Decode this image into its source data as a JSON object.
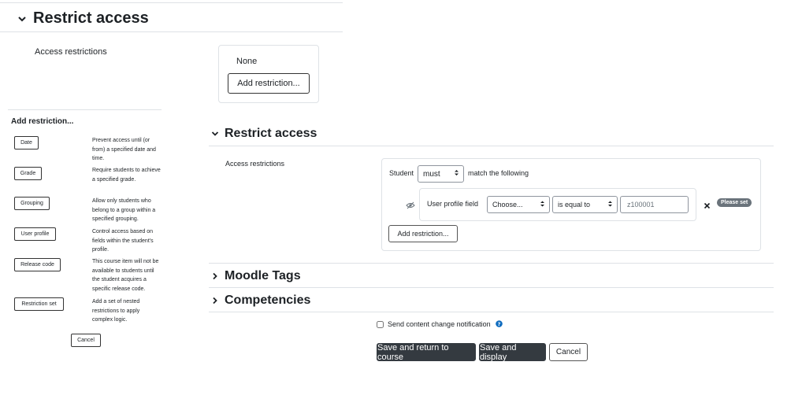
{
  "top_section": {
    "title": "Restrict access",
    "label": "Access restrictions",
    "none_text": "None",
    "add_button": "Add restriction..."
  },
  "dialog": {
    "title": "Add restriction...",
    "items": [
      {
        "button": "Date",
        "desc": "Prevent access until (or from) a specified date and time."
      },
      {
        "button": "Grade",
        "desc": "Require students to achieve a specified grade."
      },
      {
        "button": "Grouping",
        "desc": "Allow only students who belong to a group within a specified grouping."
      },
      {
        "button": "User profile",
        "desc": "Control access based on fields within the student's profile."
      },
      {
        "button": "Release code",
        "desc": "This course item will not be available to students until the student acquires a specific release code."
      },
      {
        "button": "Restriction set",
        "desc": "Add a set of nested restrictions to apply complex logic."
      }
    ],
    "cancel": "Cancel"
  },
  "main_section": {
    "title": "Restrict access",
    "label": "Access restrictions",
    "student_label": "Student",
    "must_select": "must",
    "match_text": "match the following",
    "condition": {
      "field_label": "User profile field",
      "field_select": "Choose...",
      "operator_select": "is equal to",
      "value_input": "z100001",
      "badge": "Please set"
    },
    "add_button": "Add restriction..."
  },
  "collapsed_sections": [
    {
      "title": "Moodle Tags"
    },
    {
      "title": "Competencies"
    }
  ],
  "notification": {
    "label": "Send content change notification"
  },
  "footer": {
    "save_return": "Save and return to course",
    "save_display": "Save and display",
    "cancel": "Cancel"
  },
  "colors": {
    "dark_button": "#343a40",
    "badge": "#6a737b",
    "help_icon": "#0f6cbf",
    "border": "#dee2e6"
  }
}
